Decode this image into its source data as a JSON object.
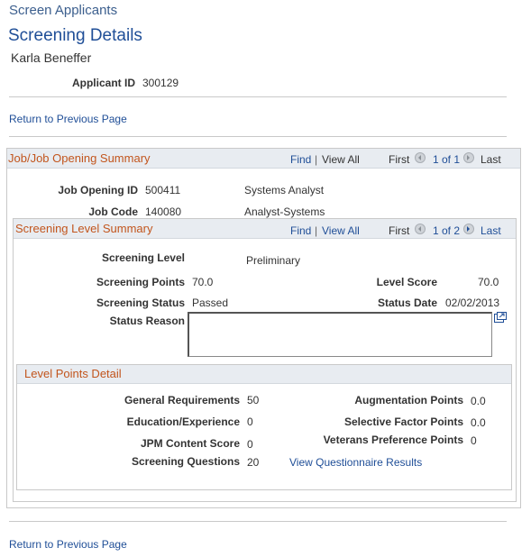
{
  "breadcrumb": "Screen Applicants",
  "page_title": "Screening Details",
  "applicant_name": "Karla Beneffer",
  "applicant_id": {
    "label": "Applicant ID",
    "value": "300129"
  },
  "return_link": "Return to Previous Page",
  "job_summary": {
    "title": "Job/Job Opening Summary",
    "find": "Find",
    "sep": "|",
    "view_all": "View All",
    "first": "First",
    "count": "1 of 1",
    "last": "Last",
    "job_opening_id": {
      "label": "Job Opening ID",
      "value": "500411",
      "desc": "Systems Analyst"
    },
    "job_code": {
      "label": "Job Code",
      "value": "140080",
      "desc": "Analyst-Systems"
    }
  },
  "screening_summary": {
    "title": "Screening Level Summary",
    "find": "Find",
    "sep": "|",
    "view_all": "View All",
    "first": "First",
    "count": "1 of 2",
    "last": "Last",
    "screening_level": {
      "label": "Screening Level",
      "value": "Preliminary"
    },
    "screening_points": {
      "label": "Screening Points",
      "value": "70.0"
    },
    "level_score": {
      "label": "Level Score",
      "value": "70.0"
    },
    "screening_status": {
      "label": "Screening Status",
      "value": "Passed"
    },
    "status_date": {
      "label": "Status Date",
      "value": "02/02/2013"
    },
    "status_reason": {
      "label": "Status Reason",
      "value": ""
    }
  },
  "level_points": {
    "title": "Level Points Detail",
    "general_requirements": {
      "label": "General Requirements",
      "value": "50"
    },
    "education_experience": {
      "label": "Education/Experience",
      "value": "0"
    },
    "jpm_content_score": {
      "label": "JPM Content Score",
      "value": "0"
    },
    "screening_questions": {
      "label": "Screening Questions",
      "value": "20"
    },
    "questionnaire_link": "View Questionnaire Results",
    "augmentation_points": {
      "label": "Augmentation Points",
      "value": "0.0"
    },
    "selective_factor_points": {
      "label": "Selective Factor Points",
      "value": "0.0"
    },
    "veterans_preference_points": {
      "label": "Veterans Preference Points",
      "value": "0"
    }
  },
  "icons": {
    "prev": "chevron-left-icon",
    "next": "chevron-right-icon",
    "expand": "expand-window-icon"
  }
}
